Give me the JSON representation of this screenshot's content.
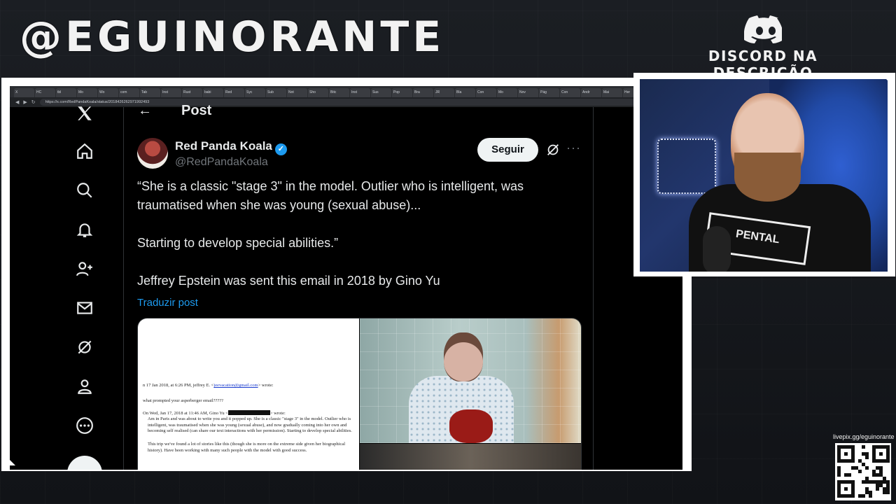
{
  "overlay": {
    "brand": "@EGUINORANTE",
    "discord_label": "DISCORD NA DESCRIÇÃO",
    "qr_label": "livepix.gg/eguinorante"
  },
  "browser": {
    "url": "https://x.com/RedPandaKoala/status/2018426262971992493",
    "tabs": [
      "X",
      "HC",
      "tbl",
      "Mo",
      "Wo",
      "com",
      "Tab",
      "Inst",
      "Rust",
      "babi",
      "Red",
      "Syc",
      "Sub",
      "Not",
      "Sho",
      "Bitc",
      "Inst",
      "Sus",
      "Pop",
      "Bra",
      "JR",
      "Bla",
      "Con",
      "Mo",
      "Nov",
      "Pág",
      "Con",
      "Andr",
      "Mai",
      "Her"
    ]
  },
  "x": {
    "header_title": "Post",
    "author": {
      "display_name": "Red Panda Koala",
      "handle": "@RedPandaKoala"
    },
    "follow_label": "Seguir",
    "tweet": {
      "line1": "“She is a classic \"stage 3\" in the model. Outlier who is intelligent, was traumatised when she was young (sexual abuse)...",
      "line2": "Starting to develop special abilities.”",
      "line3": "Jeffrey Epstein was sent this email in 2018 by Gino Yu"
    },
    "translate_label": "Traduzir post",
    "email_image": {
      "line_a": "n 17 Jan 2018, at 6:26 PM, jeffrey E. <",
      "line_a_link": "jeevacation@gmail.com",
      "line_a_end": "> wrote:",
      "line_b": "what prompted your asperberger email?????",
      "line_c": "On Wed, Jan 17, 2018 at 11:46 AM, Gino Yu <",
      "line_c_end": "> wrote:",
      "para1": "Am in Paris and was about to write you and it popped up. She is a classic \"stage 3\" in the model. Outlier who is intelligent, was traumatised when she was young (sexual abuse), and now gradually coming into her own and becoming self realised (can share our text interactions with her permission). Starting to develop special abilities.",
      "para2": "This trip we've found a lot of stories like this (though she is more on the extreme side given her biographical history). Have been working with many such people with the model with good success."
    }
  },
  "colors": {
    "x_blue": "#1d9bf0",
    "x_text": "#e7e9ea",
    "x_muted": "#71767b"
  }
}
